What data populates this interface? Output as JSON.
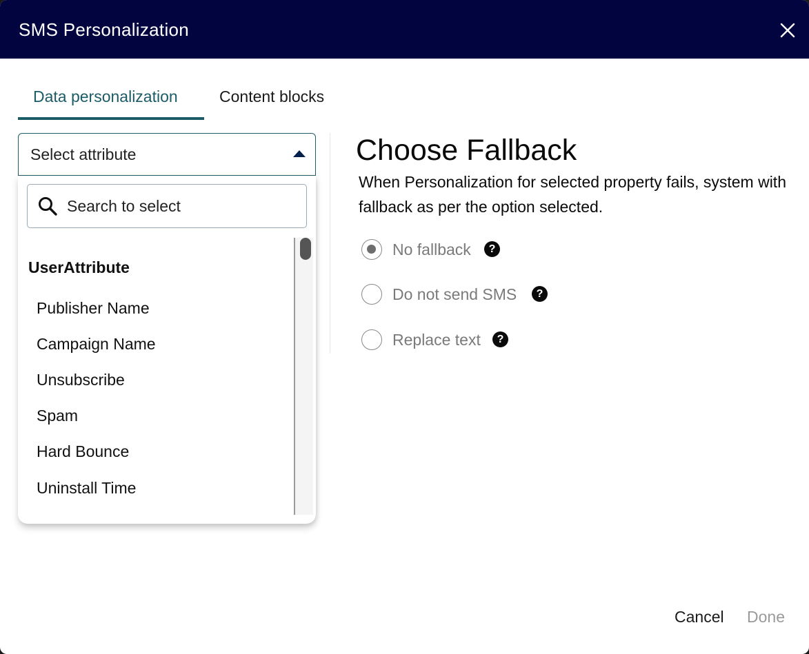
{
  "modal": {
    "title": "SMS Personalization",
    "close_icon": "close-icon"
  },
  "tabs": [
    {
      "label": "Data personalization",
      "active": true
    },
    {
      "label": "Content blocks",
      "active": false
    }
  ],
  "attribute_select": {
    "value": "Select attribute",
    "caret_icon": "caret-up-icon",
    "search_placeholder": "Search to select",
    "search_icon": "search-icon",
    "group_label": "UserAttribute",
    "options": [
      "Publisher Name",
      "Campaign Name",
      "Unsubscribe",
      "Spam",
      "Hard Bounce",
      "Uninstall Time"
    ]
  },
  "fallback": {
    "title": "Choose Fallback",
    "description": "When Personalization for selected property fails, system with fallback as per the option selected.",
    "options": [
      {
        "label": "No fallback",
        "selected": true,
        "help": "?"
      },
      {
        "label": "Do not send SMS",
        "selected": false,
        "help": "?"
      },
      {
        "label": "Replace text",
        "selected": false,
        "help": "?"
      }
    ]
  },
  "footer": {
    "cancel_label": "Cancel",
    "done_label": "Done"
  },
  "colors": {
    "header_bg": "#02043f",
    "accent": "#1b5c66",
    "disabled_text": "#9a9a9a"
  }
}
